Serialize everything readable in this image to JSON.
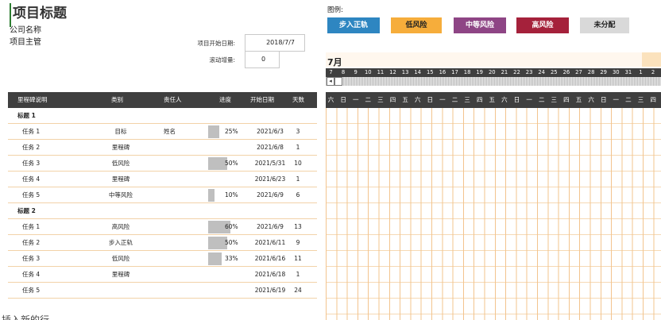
{
  "header": {
    "title": "项目标题",
    "company": "公司名称",
    "manager": "项目主管"
  },
  "fields": {
    "start_date_label": "项目开始日期:",
    "start_date_value": "2018/7/7",
    "scroll_label": "滚动增量:",
    "scroll_value": "0"
  },
  "legend": {
    "title": "图例:",
    "items": [
      {
        "label": "步入正轨",
        "bg": "#2e86c1",
        "fg": "#ffffff"
      },
      {
        "label": "低风险",
        "bg": "#f6ad3b",
        "fg": "#222222"
      },
      {
        "label": "中等风险",
        "bg": "#8e4585",
        "fg": "#ffffff"
      },
      {
        "label": "高风险",
        "bg": "#a5213b",
        "fg": "#ffffff"
      },
      {
        "label": "未分配",
        "bg": "#d9d9d9",
        "fg": "#222222"
      }
    ]
  },
  "table": {
    "columns": [
      "里程碑说明",
      "类别",
      "责任人",
      "进度",
      "开始日期",
      "天数"
    ],
    "rows": [
      {
        "kind": "group",
        "name": "标题 1"
      },
      {
        "kind": "task",
        "name": "任务 1",
        "category": "目标",
        "owner": "姓名",
        "progress": "25%",
        "progress_value": 25,
        "start": "2021/6/3",
        "days": "3"
      },
      {
        "kind": "task",
        "name": "任务 2",
        "category": "里程碑",
        "owner": "",
        "progress": "",
        "progress_value": 0,
        "start": "2021/6/8",
        "days": "1"
      },
      {
        "kind": "task",
        "name": "任务 3",
        "category": "低风险",
        "owner": "",
        "progress": "50%",
        "progress_value": 50,
        "start": "2021/5/31",
        "days": "10"
      },
      {
        "kind": "task",
        "name": "任务 4",
        "category": "里程碑",
        "owner": "",
        "progress": "",
        "progress_value": 0,
        "start": "2021/6/23",
        "days": "1"
      },
      {
        "kind": "task",
        "name": "任务 5",
        "category": "中等风险",
        "owner": "",
        "progress": "10%",
        "progress_value": 10,
        "start": "2021/6/9",
        "days": "6"
      },
      {
        "kind": "group",
        "name": "标题 2"
      },
      {
        "kind": "task",
        "name": "任务 1",
        "category": "高风险",
        "owner": "",
        "progress": "60%",
        "progress_value": 60,
        "start": "2021/6/9",
        "days": "13"
      },
      {
        "kind": "task",
        "name": "任务 2",
        "category": "步入正轨",
        "owner": "",
        "progress": "50%",
        "progress_value": 50,
        "start": "2021/6/11",
        "days": "9"
      },
      {
        "kind": "task",
        "name": "任务 3",
        "category": "低风险",
        "owner": "",
        "progress": "33%",
        "progress_value": 33,
        "start": "2021/6/16",
        "days": "11"
      },
      {
        "kind": "task",
        "name": "任务 4",
        "category": "里程碑",
        "owner": "",
        "progress": "",
        "progress_value": 0,
        "start": "2021/6/18",
        "days": "1"
      },
      {
        "kind": "task",
        "name": "任务 5",
        "category": "",
        "owner": "",
        "progress": "",
        "progress_value": 0,
        "start": "2021/6/19",
        "days": "24"
      }
    ]
  },
  "gantt": {
    "month": "7月",
    "day_numbers": [
      "7",
      "8",
      "9",
      "10",
      "11",
      "12",
      "13",
      "14",
      "15",
      "16",
      "17",
      "18",
      "19",
      "20",
      "21",
      "22",
      "23",
      "24",
      "25",
      "26",
      "27",
      "28",
      "29",
      "30",
      "31",
      "1",
      "2"
    ],
    "weekdays": [
      "六",
      "日",
      "一",
      "二",
      "三",
      "四",
      "五",
      "六",
      "日",
      "一",
      "二",
      "三",
      "四",
      "五",
      "六",
      "日",
      "一",
      "二",
      "三",
      "四",
      "五",
      "六",
      "日",
      "一",
      "二",
      "三",
      "四"
    ]
  },
  "footer": {
    "text": "插入新的行..."
  }
}
